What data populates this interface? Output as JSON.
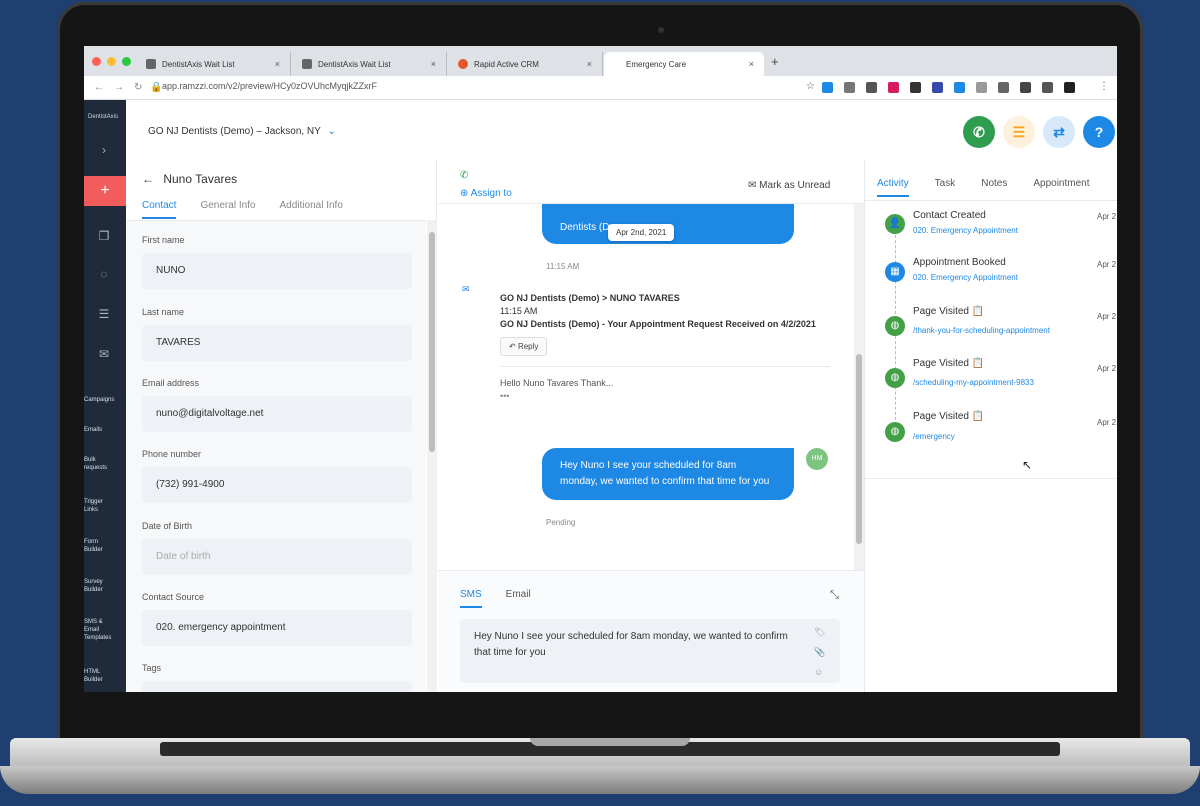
{
  "browser": {
    "tabs": [
      {
        "label": "DentistAxis Wait List",
        "close": "×"
      },
      {
        "label": "DentistAxis Wait List",
        "close": "×"
      },
      {
        "label": "Rapid Active CRM",
        "close": "×"
      },
      {
        "label": "Emergency Care",
        "close": "×"
      }
    ],
    "new_tab": "+",
    "url": "app.ramzzi.com/v2/preview/HCy0zOVUhcMyqjkZZxrF"
  },
  "sidebar": {
    "logo": "DentistAxis",
    "add": "+",
    "labels": [
      "Campaigns",
      "Emails",
      "Bulk requests",
      "Trigger Links",
      "Form Builder",
      "Survey Builder",
      "SMS & Email Templates",
      "HTML Builder"
    ]
  },
  "header": {
    "location": "GO NJ Dentists (Demo) – Jackson, NY",
    "help": "?"
  },
  "contact": {
    "name": "Nuno Tavares",
    "tabs": [
      "Contact",
      "General Info",
      "Additional Info"
    ],
    "fields": [
      {
        "label": "First name",
        "value": "NUNO"
      },
      {
        "label": "Last name",
        "value": "TAVARES"
      },
      {
        "label": "Email address",
        "value": "nuno@digitalvoltage.net"
      },
      {
        "label": "Phone number",
        "value": "(732) 991-4900"
      },
      {
        "label": "Date of Birth",
        "placeholder": "Date of birth"
      },
      {
        "label": "Contact Source",
        "value": "020. emergency appointment"
      },
      {
        "label": "Tags",
        "value": ""
      }
    ]
  },
  "conversation": {
    "assign": "Assign to",
    "mark_unread": "Mark as Unread",
    "top_bubble": "Dentists (De",
    "date_chip": "Apr 2nd, 2021",
    "top_time": "11:15 AM",
    "email": {
      "route": "GO NJ Dentists (Demo) > NUNO TAVARES",
      "time": "11:15 AM",
      "subject": "GO NJ Dentists (Demo) - Your Appointment Request Received on 4/2/2021",
      "reply": "Reply",
      "preview": "Hello Nuno Tavares Thank...",
      "ellipsis": "•••"
    },
    "sms_bubble": "Hey Nuno I see your scheduled for 8am monday, we wanted to confirm that time for you",
    "avatar": "HM",
    "status": "Pending",
    "composer_tabs": [
      "SMS",
      "Email"
    ],
    "composer_text": "Hey Nuno I see your scheduled for 8am monday, we wanted to confirm that time for you"
  },
  "activity": {
    "tabs": [
      "Activity",
      "Task",
      "Notes",
      "Appointment"
    ],
    "items": [
      {
        "title": "Contact Created",
        "sub": "020. Emergency Appointment",
        "date": "Apr 2",
        "color": "#43a047"
      },
      {
        "title": "Appointment Booked",
        "sub": "020. Emergency Appointment",
        "date": "Apr 2",
        "color": "#1e88e5"
      },
      {
        "title": "Page Visited",
        "sub": "/thank-you-for-scheduling-appointment",
        "date": "Apr 2",
        "color": "#43a047"
      },
      {
        "title": "Page Visited",
        "sub": "/scheduling-my-appointment-9833",
        "date": "Apr 2",
        "color": "#43a047"
      },
      {
        "title": "Page Visited",
        "sub": "/emergency",
        "date": "Apr 2",
        "color": "#43a047"
      }
    ]
  }
}
